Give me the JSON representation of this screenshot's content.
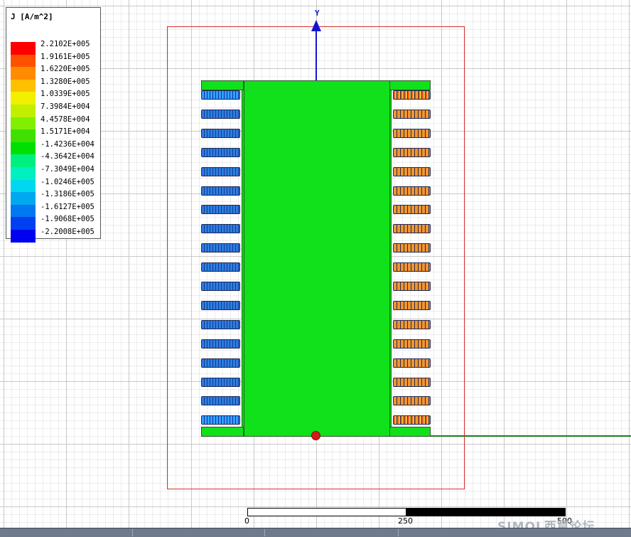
{
  "legend": {
    "title": "J [A/m^2]",
    "entries": [
      {
        "label": "2.2102E+005",
        "color": "#ff0000"
      },
      {
        "label": "1.9161E+005",
        "color": "#ff5000"
      },
      {
        "label": "1.6220E+005",
        "color": "#ff8c00"
      },
      {
        "label": "1.3280E+005",
        "color": "#ffc000"
      },
      {
        "label": "1.0339E+005",
        "color": "#f0f000"
      },
      {
        "label": "7.3984E+004",
        "color": "#c0f000"
      },
      {
        "label": "4.4578E+004",
        "color": "#80f000"
      },
      {
        "label": "1.5171E+004",
        "color": "#40e000"
      },
      {
        "label": "-1.4236E+004",
        "color": "#00e000"
      },
      {
        "label": "-4.3642E+004",
        "color": "#00f080"
      },
      {
        "label": "-7.3049E+004",
        "color": "#00f0c0"
      },
      {
        "label": "-1.0246E+005",
        "color": "#00d8f0"
      },
      {
        "label": "-1.3186E+005",
        "color": "#00a8f0"
      },
      {
        "label": "-1.6127E+005",
        "color": "#0078f0"
      },
      {
        "label": "-1.9068E+005",
        "color": "#0040f0"
      },
      {
        "label": "-2.2008E+005",
        "color": "#0000f0"
      }
    ]
  },
  "axis": {
    "y_label": "Y"
  },
  "scale": {
    "label_0": "0",
    "label_250": "250",
    "label_500": "500 (mm)"
  },
  "watermark": "SIMOL西莫论坛"
}
